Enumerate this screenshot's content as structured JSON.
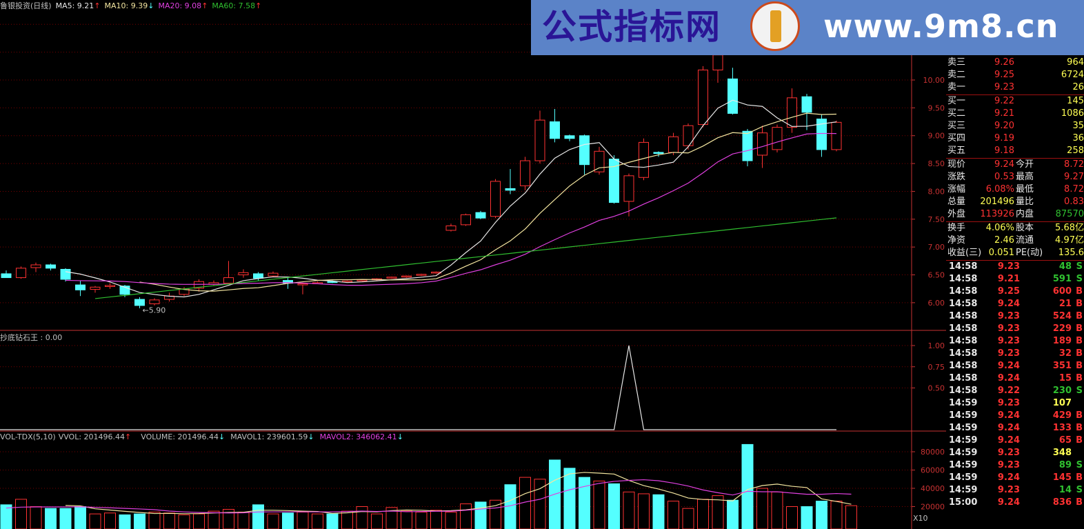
{
  "colors": {
    "up": "#ff3232",
    "down": "#54ffff",
    "ma5": "#e8e8e8",
    "ma10": "#f4e6a0",
    "ma20": "#e040e0",
    "ma60": "#30c030",
    "grid": "#7a0000",
    "axis": "#c83232",
    "label": "#c0c0c0"
  },
  "price_legend": {
    "title": "鲁银投资(日线)",
    "ma5": "MA5: 9.21",
    "ma5_arrow": "↑",
    "ma10": "MA10: 9.39",
    "ma10_arrow": "↓",
    "ma20": "MA20: 9.08",
    "ma20_arrow": "↑",
    "ma60": "MA60: 7.58",
    "ma60_arrow": "↑"
  },
  "indicator_legend": {
    "label": "抄底钻石王 : 0.00"
  },
  "volume_legend": {
    "title": "VOL-TDX(5,10)",
    "vvol": "VVOL: 201496.44",
    "vvol_arrow": "↑",
    "volume": "VOLUME: 201496.44",
    "volume_arrow": "↓",
    "mavol1": "MAVOL1: 239601.59",
    "mavol1_arrow": "↓",
    "mavol2": "MAVOL2: 346062.41",
    "mavol2_arrow": "↓"
  },
  "banner": {
    "title": "公式指标网",
    "url": "www.9m8.cn"
  },
  "chart_data": [
    {
      "type": "candlestick",
      "title": "鲁银投资(日线)",
      "y_ticks": [
        "10.00",
        "9.50",
        "9.00",
        "8.50",
        "8.00",
        "7.50",
        "7.00",
        "6.50",
        "6.00"
      ],
      "ylim": [
        5.7,
        10.6
      ],
      "annotation": "←5.90",
      "candles": [
        {
          "o": 6.52,
          "h": 6.58,
          "l": 6.45,
          "c": 6.45
        },
        {
          "o": 6.45,
          "h": 6.65,
          "l": 6.43,
          "c": 6.62
        },
        {
          "o": 6.63,
          "h": 6.72,
          "l": 6.55,
          "c": 6.68
        },
        {
          "o": 6.68,
          "h": 6.7,
          "l": 6.58,
          "c": 6.62
        },
        {
          "o": 6.6,
          "h": 6.62,
          "l": 6.38,
          "c": 6.42
        },
        {
          "o": 6.32,
          "h": 6.4,
          "l": 6.12,
          "c": 6.23
        },
        {
          "o": 6.24,
          "h": 6.3,
          "l": 6.18,
          "c": 6.28
        },
        {
          "o": 6.29,
          "h": 6.35,
          "l": 6.25,
          "c": 6.31
        },
        {
          "o": 6.3,
          "h": 6.32,
          "l": 6.1,
          "c": 6.15
        },
        {
          "o": 6.06,
          "h": 6.1,
          "l": 5.9,
          "c": 5.95
        },
        {
          "o": 5.98,
          "h": 6.08,
          "l": 5.95,
          "c": 6.05
        },
        {
          "o": 6.06,
          "h": 6.18,
          "l": 6.02,
          "c": 6.12
        },
        {
          "o": 6.15,
          "h": 6.28,
          "l": 6.12,
          "c": 6.25
        },
        {
          "o": 6.26,
          "h": 6.42,
          "l": 6.2,
          "c": 6.38
        },
        {
          "o": 6.33,
          "h": 6.4,
          "l": 6.3,
          "c": 6.36
        },
        {
          "o": 6.35,
          "h": 6.75,
          "l": 6.33,
          "c": 6.45
        },
        {
          "o": 6.5,
          "h": 6.6,
          "l": 6.45,
          "c": 6.54
        },
        {
          "o": 6.52,
          "h": 6.55,
          "l": 6.4,
          "c": 6.44
        },
        {
          "o": 6.48,
          "h": 6.56,
          "l": 6.46,
          "c": 6.53
        },
        {
          "o": 6.4,
          "h": 6.45,
          "l": 6.25,
          "c": 6.35
        },
        {
          "o": 6.32,
          "h": 6.36,
          "l": 6.15,
          "c": 6.34
        },
        {
          "o": 6.36,
          "h": 6.38,
          "l": 6.34,
          "c": 6.36
        },
        {
          "o": 6.38,
          "h": 6.4,
          "l": 6.35,
          "c": 6.37
        },
        {
          "o": 6.38,
          "h": 6.4,
          "l": 6.36,
          "c": 6.39
        },
        {
          "o": 6.4,
          "h": 6.42,
          "l": 6.38,
          "c": 6.41
        },
        {
          "o": 6.42,
          "h": 6.44,
          "l": 6.4,
          "c": 6.43
        },
        {
          "o": 6.45,
          "h": 6.47,
          "l": 6.43,
          "c": 6.46
        },
        {
          "o": 6.47,
          "h": 6.49,
          "l": 6.45,
          "c": 6.48
        },
        {
          "o": 6.5,
          "h": 6.52,
          "l": 6.48,
          "c": 6.51
        },
        {
          "o": 6.54,
          "h": 6.56,
          "l": 6.52,
          "c": 6.55
        },
        {
          "o": 7.3,
          "h": 7.42,
          "l": 7.28,
          "c": 7.38
        },
        {
          "o": 7.4,
          "h": 7.6,
          "l": 7.38,
          "c": 7.58
        },
        {
          "o": 7.62,
          "h": 7.65,
          "l": 7.5,
          "c": 7.52
        },
        {
          "o": 7.55,
          "h": 8.22,
          "l": 7.52,
          "c": 8.18
        },
        {
          "o": 8.05,
          "h": 8.4,
          "l": 7.95,
          "c": 8.02
        },
        {
          "o": 8.1,
          "h": 8.62,
          "l": 8.02,
          "c": 8.55
        },
        {
          "o": 8.55,
          "h": 9.45,
          "l": 8.5,
          "c": 9.28
        },
        {
          "o": 9.25,
          "h": 9.48,
          "l": 8.88,
          "c": 8.95
        },
        {
          "o": 9.0,
          "h": 9.02,
          "l": 8.9,
          "c": 8.95
        },
        {
          "o": 9.0,
          "h": 9.02,
          "l": 8.3,
          "c": 8.48
        },
        {
          "o": 8.35,
          "h": 8.8,
          "l": 8.3,
          "c": 8.72
        },
        {
          "o": 8.58,
          "h": 8.65,
          "l": 7.78,
          "c": 7.8
        },
        {
          "o": 7.82,
          "h": 8.32,
          "l": 7.55,
          "c": 8.28
        },
        {
          "o": 8.25,
          "h": 8.95,
          "l": 8.2,
          "c": 8.88
        },
        {
          "o": 8.7,
          "h": 8.72,
          "l": 8.62,
          "c": 8.68
        },
        {
          "o": 8.7,
          "h": 9.05,
          "l": 8.65,
          "c": 8.98
        },
        {
          "o": 8.82,
          "h": 9.22,
          "l": 8.75,
          "c": 9.18
        },
        {
          "o": 9.2,
          "h": 10.25,
          "l": 9.15,
          "c": 10.18
        },
        {
          "o": 10.18,
          "h": 10.8,
          "l": 9.95,
          "c": 10.45
        },
        {
          "o": 10.02,
          "h": 10.22,
          "l": 9.38,
          "c": 9.4
        },
        {
          "o": 9.08,
          "h": 9.12,
          "l": 8.45,
          "c": 8.55
        },
        {
          "o": 8.65,
          "h": 9.18,
          "l": 8.42,
          "c": 9.05
        },
        {
          "o": 8.75,
          "h": 9.2,
          "l": 8.7,
          "c": 9.15
        },
        {
          "o": 9.15,
          "h": 9.85,
          "l": 9.05,
          "c": 9.68
        },
        {
          "o": 9.7,
          "h": 9.75,
          "l": 9.1,
          "c": 9.42
        },
        {
          "o": 9.3,
          "h": 9.38,
          "l": 8.62,
          "c": 8.75
        },
        {
          "o": 8.75,
          "h": 9.27,
          "l": 8.72,
          "c": 9.24
        }
      ]
    },
    {
      "type": "line",
      "title": "抄底钻石王",
      "y_ticks": [
        "1.00",
        "0.75",
        "0.50"
      ],
      "ylim": [
        0,
        1.05
      ],
      "spike_index": 42,
      "values_note_count": 58
    },
    {
      "type": "bar",
      "title": "VOL-TDX(5,10)",
      "y_ticks": [
        "80000",
        "60000",
        "40000",
        "20000"
      ],
      "ylim": [
        0,
        95000
      ],
      "unit": "X10",
      "values": [
        22000,
        28000,
        20000,
        18000,
        18000,
        20000,
        12000,
        13000,
        11000,
        12000,
        14000,
        13000,
        11000,
        12000,
        15000,
        17000,
        14000,
        22000,
        12000,
        13000,
        14000,
        12000,
        12000,
        15000,
        20000,
        12000,
        19000,
        15000,
        14000,
        16000,
        14000,
        23000,
        25000,
        27000,
        44000,
        52000,
        50000,
        71000,
        62000,
        52000,
        48000,
        45000,
        36000,
        34000,
        33000,
        26000,
        18000,
        28000,
        32000,
        27000,
        88000,
        40000,
        36000,
        20000,
        20000,
        26000,
        26000,
        21000
      ]
    }
  ],
  "quote_panel": {
    "asks": [
      {
        "label": "卖三",
        "price": "9.26",
        "vol": "964"
      },
      {
        "label": "卖二",
        "price": "9.25",
        "vol": "6724"
      },
      {
        "label": "卖一",
        "price": "9.23",
        "vol": "26"
      }
    ],
    "bids": [
      {
        "label": "买一",
        "price": "9.22",
        "vol": "145"
      },
      {
        "label": "买二",
        "price": "9.21",
        "vol": "1086"
      },
      {
        "label": "买三",
        "price": "9.20",
        "vol": "35"
      },
      {
        "label": "买四",
        "price": "9.19",
        "vol": "36"
      },
      {
        "label": "买五",
        "price": "9.18",
        "vol": "258"
      }
    ],
    "stats1": [
      {
        "l1": "现价",
        "v1": "9.24",
        "l2": "今开",
        "v2": "8.72"
      },
      {
        "l1": "涨跌",
        "v1": "0.53",
        "l2": "最高",
        "v2": "9.27"
      },
      {
        "l1": "涨幅",
        "v1": "6.08%",
        "l2": "最低",
        "v2": "8.72"
      },
      {
        "l1": "总量",
        "v1": "201496",
        "l2": "量比",
        "v2": "0.83"
      },
      {
        "l1": "外盘",
        "v1": "113926",
        "l2": "内盘",
        "v2": "87570"
      }
    ],
    "stats2": [
      {
        "l1": "换手",
        "v1": "4.06%",
        "l2": "股本",
        "v2": "5.68亿"
      },
      {
        "l1": "净资",
        "v1": "2.46",
        "l2": "流通",
        "v2": "4.97亿"
      },
      {
        "l1": "收益(三)",
        "v1": "0.051",
        "l2": "PE(动)",
        "v2": "135.6"
      }
    ],
    "ticks": [
      {
        "t": "14:58",
        "p": "9.23",
        "v": "48",
        "s": "S"
      },
      {
        "t": "14:58",
        "p": "9.21",
        "v": "591",
        "s": "S"
      },
      {
        "t": "14:58",
        "p": "9.25",
        "v": "600",
        "s": "B"
      },
      {
        "t": "14:58",
        "p": "9.24",
        "v": "21",
        "s": "B"
      },
      {
        "t": "14:58",
        "p": "9.23",
        "v": "524",
        "s": "B"
      },
      {
        "t": "14:58",
        "p": "9.23",
        "v": "229",
        "s": "B"
      },
      {
        "t": "14:58",
        "p": "9.23",
        "v": "189",
        "s": "B"
      },
      {
        "t": "14:58",
        "p": "9.23",
        "v": "32",
        "s": "B"
      },
      {
        "t": "14:58",
        "p": "9.24",
        "v": "351",
        "s": "B"
      },
      {
        "t": "14:58",
        "p": "9.24",
        "v": "15",
        "s": "B"
      },
      {
        "t": "14:58",
        "p": "9.22",
        "v": "230",
        "s": "S"
      },
      {
        "t": "14:59",
        "p": "9.23",
        "v": "107",
        "s": ""
      },
      {
        "t": "14:59",
        "p": "9.24",
        "v": "429",
        "s": "B"
      },
      {
        "t": "14:59",
        "p": "9.24",
        "v": "133",
        "s": "B"
      },
      {
        "t": "14:59",
        "p": "9.24",
        "v": "65",
        "s": "B"
      },
      {
        "t": "14:59",
        "p": "9.23",
        "v": "348",
        "s": ""
      },
      {
        "t": "14:59",
        "p": "9.23",
        "v": "89",
        "s": "S"
      },
      {
        "t": "14:59",
        "p": "9.24",
        "v": "145",
        "s": "B"
      },
      {
        "t": "14:59",
        "p": "9.23",
        "v": "14",
        "s": "S"
      },
      {
        "t": "15:00",
        "p": "9.24",
        "v": "836",
        "s": "B"
      }
    ]
  }
}
